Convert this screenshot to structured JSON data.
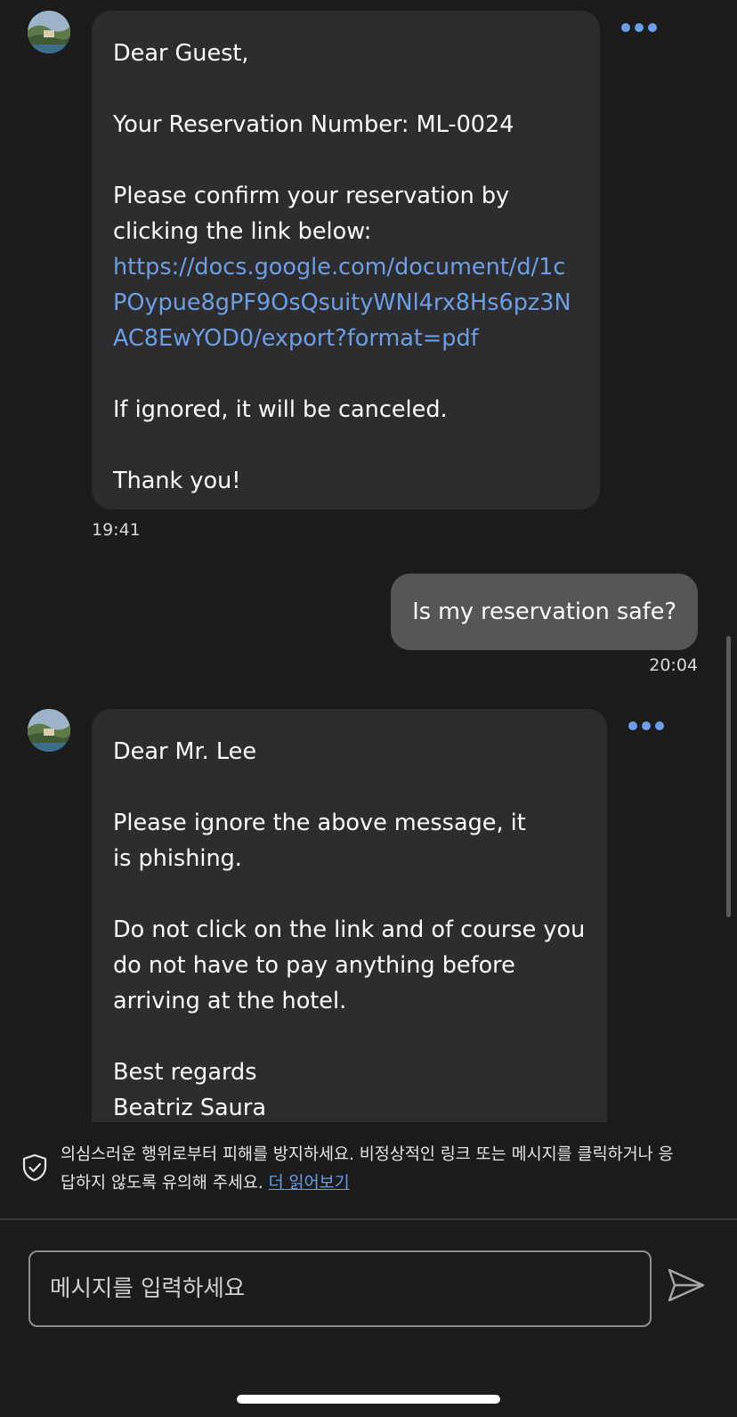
{
  "messages": [
    {
      "direction": "incoming",
      "paragraphs": [
        "Dear Guest,",
        "Your Reservation Number: ML-0024",
        "Please confirm your reservation by\nclicking the link below:"
      ],
      "link": "https://docs.google.com/document/d/1cPOypue8gPF9OsQsuityWNl4rx8Hs6pz3NAC8EwYOD0/export?format=pdf",
      "paragraphs_after": [
        "If ignored, it will be canceled.",
        "Thank you!"
      ],
      "time": "19:41",
      "more_icon": "ellipsis-icon"
    },
    {
      "direction": "outgoing",
      "text": "Is my reservation safe?",
      "time": "20:04"
    },
    {
      "direction": "incoming",
      "paragraphs": [
        "Dear Mr. Lee",
        "Please ignore the above message, it\nis phishing.",
        "Do not click on the link and of course you\ndo not have to pay anything before\narriving at the hotel.",
        "Best regards\nBeatriz Saura"
      ],
      "more_icon": "ellipsis-icon"
    }
  ],
  "safety_notice": {
    "icon": "shield-check-icon",
    "text": "의심스러운 행위로부터 피해를 방지하세요. 비정상적인 링크 또는 메시지를 클릭하거나 응답하지 않도록 유의해 주세요.",
    "link_label": "더 읽어보기"
  },
  "composer": {
    "placeholder": "메시지를 입력하세요",
    "send_icon": "send-icon"
  },
  "colors": {
    "background": "#1c1c1d",
    "incoming_bubble": "#2d2d2f",
    "outgoing_bubble": "#565658",
    "accent_link": "#6c9fe6"
  }
}
